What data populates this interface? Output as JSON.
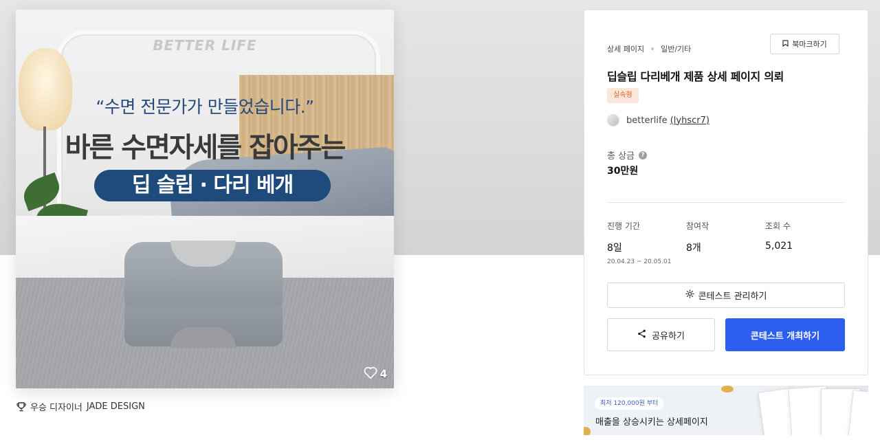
{
  "hero": {
    "brand_mark": "BETTER LIFE",
    "quote": "“수면 전문가가 만들었습니다.”",
    "headline": "바른 수면자세를 잡아주는",
    "product_pill": "딥 슬립 · 다리 베개",
    "likes_count": "4",
    "icons": {
      "like": "heart-icon"
    }
  },
  "winner": {
    "label": "우승 디자이너",
    "name": "JADE DESIGN",
    "icon": "trophy-icon"
  },
  "card": {
    "breadcrumb": {
      "section": "상세 페이지",
      "category": "일반/기타"
    },
    "bookmark_label": "북마크하기",
    "title": "딥슬립 다리베개 제품 상세 페이지 의뢰",
    "badge": "실속형",
    "author": {
      "name": "betterlife",
      "handle": "(lyhscr7)"
    },
    "prize": {
      "label": "총 상금",
      "value": "30만원"
    },
    "stats": {
      "period": {
        "label": "진행 기간",
        "value": "8일",
        "range": "20.04.23 ~ 20.05.01"
      },
      "entries": {
        "label": "참여작",
        "value": "8개"
      },
      "views": {
        "label": "조회 수",
        "value": "5,021"
      }
    },
    "manage_label": "콘테스트 관리하기",
    "share_label": "공유하기",
    "host_label": "콘테스트 개최하기"
  },
  "ad": {
    "chip": "최저 120,000원 부터",
    "text": "매출을 상승시키는 상세페이지"
  },
  "colors": {
    "primary": "#2d5ef2",
    "badge_bg": "#fbe7d9",
    "badge_text": "#d4652a",
    "pill_bg": "#1f4a7c"
  }
}
